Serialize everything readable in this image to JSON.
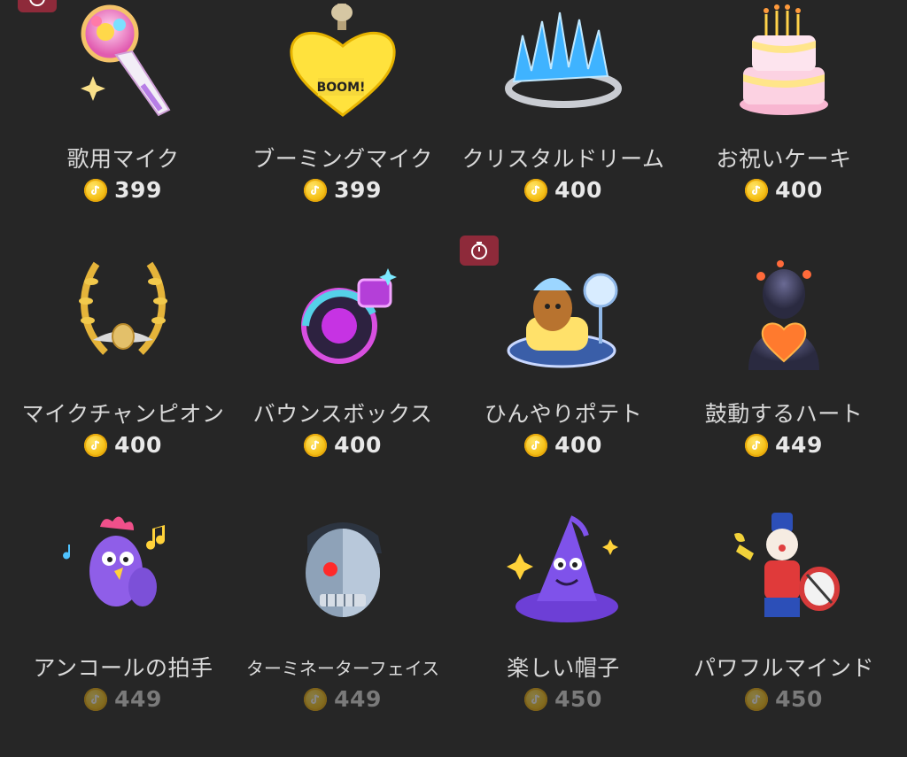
{
  "gifts": [
    {
      "name": "歌用マイク",
      "price": "399",
      "icon": "singing-microphone-icon"
    },
    {
      "name": "ブーミングマイク",
      "price": "399",
      "icon": "booming-microphone-icon"
    },
    {
      "name": "クリスタルドリーム",
      "price": "400",
      "icon": "crystal-crown-icon"
    },
    {
      "name": "お祝いケーキ",
      "price": "400",
      "icon": "celebration-cake-icon"
    },
    {
      "name": "マイクチャンピオン",
      "price": "400",
      "icon": "microphone-champion-icon"
    },
    {
      "name": "バウンスボックス",
      "price": "400",
      "icon": "bounce-box-icon"
    },
    {
      "name": "ひんやりポテト",
      "price": "400",
      "icon": "chilly-potato-icon"
    },
    {
      "name": "鼓動するハート",
      "price": "449",
      "icon": "beating-heart-icon"
    },
    {
      "name": "アンコールの拍手",
      "price": "449",
      "icon": "encore-clap-icon"
    },
    {
      "name": "ターミネーターフェイス",
      "price": "449",
      "icon": "terminator-face-icon"
    },
    {
      "name": "楽しい帽子",
      "price": "450",
      "icon": "wizard-hat-icon"
    },
    {
      "name": "パワフルマインド",
      "price": "450",
      "icon": "powerful-mind-icon"
    }
  ],
  "colors": {
    "background": "#262626",
    "coin": "#f6c21a",
    "timer_badge": "#8e2a3a"
  }
}
